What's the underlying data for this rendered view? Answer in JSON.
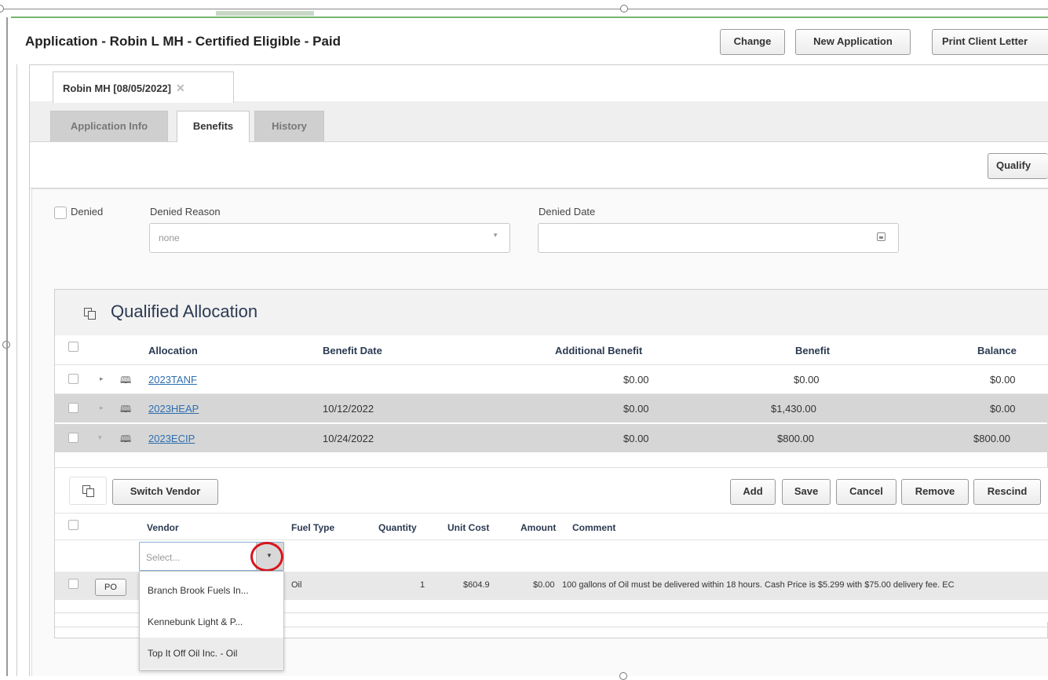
{
  "app": {
    "title": "Application - Robin L MH - Certified Eligible - Paid"
  },
  "toolbar": {
    "change": "Change",
    "new_application": "New Application",
    "print_client_letter": "Print Client Letter"
  },
  "doc_tab": {
    "label": "Robin MH [08/05/2022]",
    "close_glyph": "✕"
  },
  "tabs": [
    {
      "label": "Application Info",
      "active": false
    },
    {
      "label": "Benefits",
      "active": true
    },
    {
      "label": "History",
      "active": false
    }
  ],
  "qualify_button": "Qualify",
  "denied": {
    "checkbox_label": "Denied",
    "reason_label": "Denied Reason",
    "reason_value": "none",
    "date_label": "Denied Date",
    "date_value": ""
  },
  "qualified_allocation": {
    "title": "Qualified Allocation",
    "columns": [
      "Allocation",
      "Benefit Date",
      "Additional Benefit",
      "Benefit",
      "Balance"
    ],
    "rows": [
      {
        "allocation": "2023TANF",
        "benefit_date": "",
        "additional_benefit": "$0.00",
        "benefit": "$0.00",
        "balance": "$0.00",
        "expanded": false
      },
      {
        "allocation": "2023HEAP",
        "benefit_date": "10/12/2022",
        "additional_benefit": "$0.00",
        "benefit": "$1,430.00",
        "balance": "$0.00",
        "expanded": false
      },
      {
        "allocation": "2023ECIP",
        "benefit_date": "10/24/2022",
        "additional_benefit": "$0.00",
        "benefit": "$800.00",
        "balance": "$800.00",
        "expanded": true
      }
    ]
  },
  "vendor": {
    "switch_vendor": "Switch Vendor",
    "actions": [
      "Add",
      "Save",
      "Cancel",
      "Remove",
      "Rescind"
    ],
    "columns": [
      "Vendor",
      "Fuel Type",
      "Quantity",
      "Unit Cost",
      "Amount",
      "Comment"
    ],
    "select_placeholder": "Select...",
    "row": {
      "po": "PO",
      "fuel_type": "Oil",
      "quantity": "1",
      "unit_cost": "$604.9",
      "amount": "$0.00",
      "comment": "100 gallons of Oil must be delivered within 18 hours. Cash Price is $5.299 with $75.00 delivery fee. EC"
    },
    "dropdown_options": [
      "Branch Brook Fuels In...",
      "Kennebunk Light & P...",
      "Top It Off Oil Inc. - Oil"
    ]
  },
  "colors": {
    "link": "#2d6fb0",
    "highlight_circle": "#d8151b",
    "header_text": "#2b3a52",
    "row_selected": "#d6d6d6"
  },
  "icons": {
    "allocation_row": "book-icon",
    "panel_toggle": "panel-icon",
    "calendar": "calendar-icon"
  }
}
